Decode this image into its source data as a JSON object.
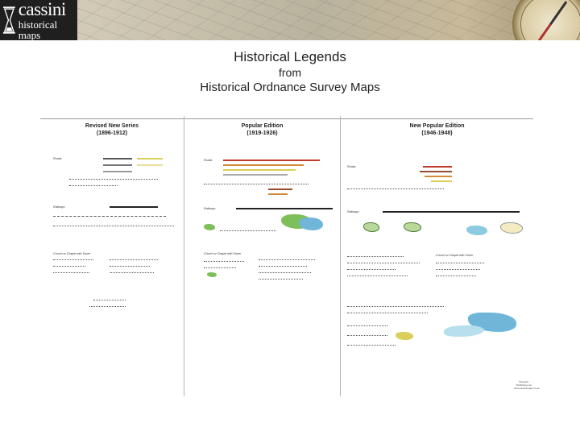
{
  "banner": {
    "logo_name": "cassini",
    "logo_subtitle": "historical maps",
    "logo_icon": "hourglass-icon",
    "decor_icon": "compass-icon"
  },
  "titles": {
    "line1": "Historical Legends",
    "line2": "from",
    "line3": "Historical Ordnance Survey Maps"
  },
  "columns": [
    {
      "name": "Revised New Series",
      "years": "(1896-1912)"
    },
    {
      "name": "Popular Edition",
      "years": "(1919-1926)"
    },
    {
      "name": "New Popular Edition",
      "years": "(1946-1948)"
    }
  ],
  "legend": {
    "revised": {
      "roads_label": "Roads",
      "rail_label": "Railways",
      "church_label": "Church or Chapel with Tower"
    },
    "popular": {
      "roads_label": "Roads",
      "rail_label": "Railways",
      "church_label": "Church or Chapel with Tower"
    },
    "newpopular": {
      "roads_label": "Roads",
      "rail_label": "Railways",
      "church_label": "Church or Chapel with Tower"
    }
  },
  "footer": {
    "copyright": "©Cassini Publishing Ltd www.cassinimaps.co.uk"
  },
  "colors": {
    "road_orange": "#d08a3a",
    "road_yellow": "#d9cf5a",
    "rail_black": "#222222",
    "wood_green": "#7fbf5a",
    "water_blue": "#6fb6d9",
    "brown_main": "#9a4b2e"
  }
}
